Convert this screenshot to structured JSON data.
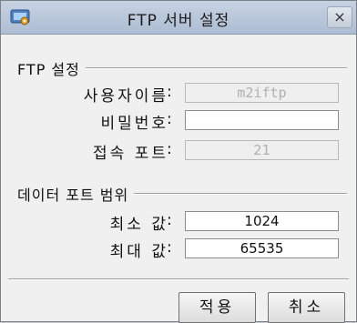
{
  "window": {
    "title": "FTP 서버 설정",
    "close_label": "×"
  },
  "ftp_group": {
    "title": "FTP 설정",
    "username": {
      "label": "사용자이름",
      "value": "m2iftp"
    },
    "password": {
      "label": "비밀번호",
      "value": ""
    },
    "port": {
      "label": "접속 포트",
      "value": "21"
    }
  },
  "data_port_group": {
    "title": "데이터 포트 범위",
    "min": {
      "label": "최소 값",
      "value": "1024"
    },
    "max": {
      "label": "최대 값",
      "value": "65535"
    }
  },
  "colon": ":",
  "buttons": {
    "apply": "적용",
    "cancel": "취소"
  },
  "colors": {
    "titlebar": "#aebdd3",
    "dialog_bg": "#f0f0f0"
  }
}
